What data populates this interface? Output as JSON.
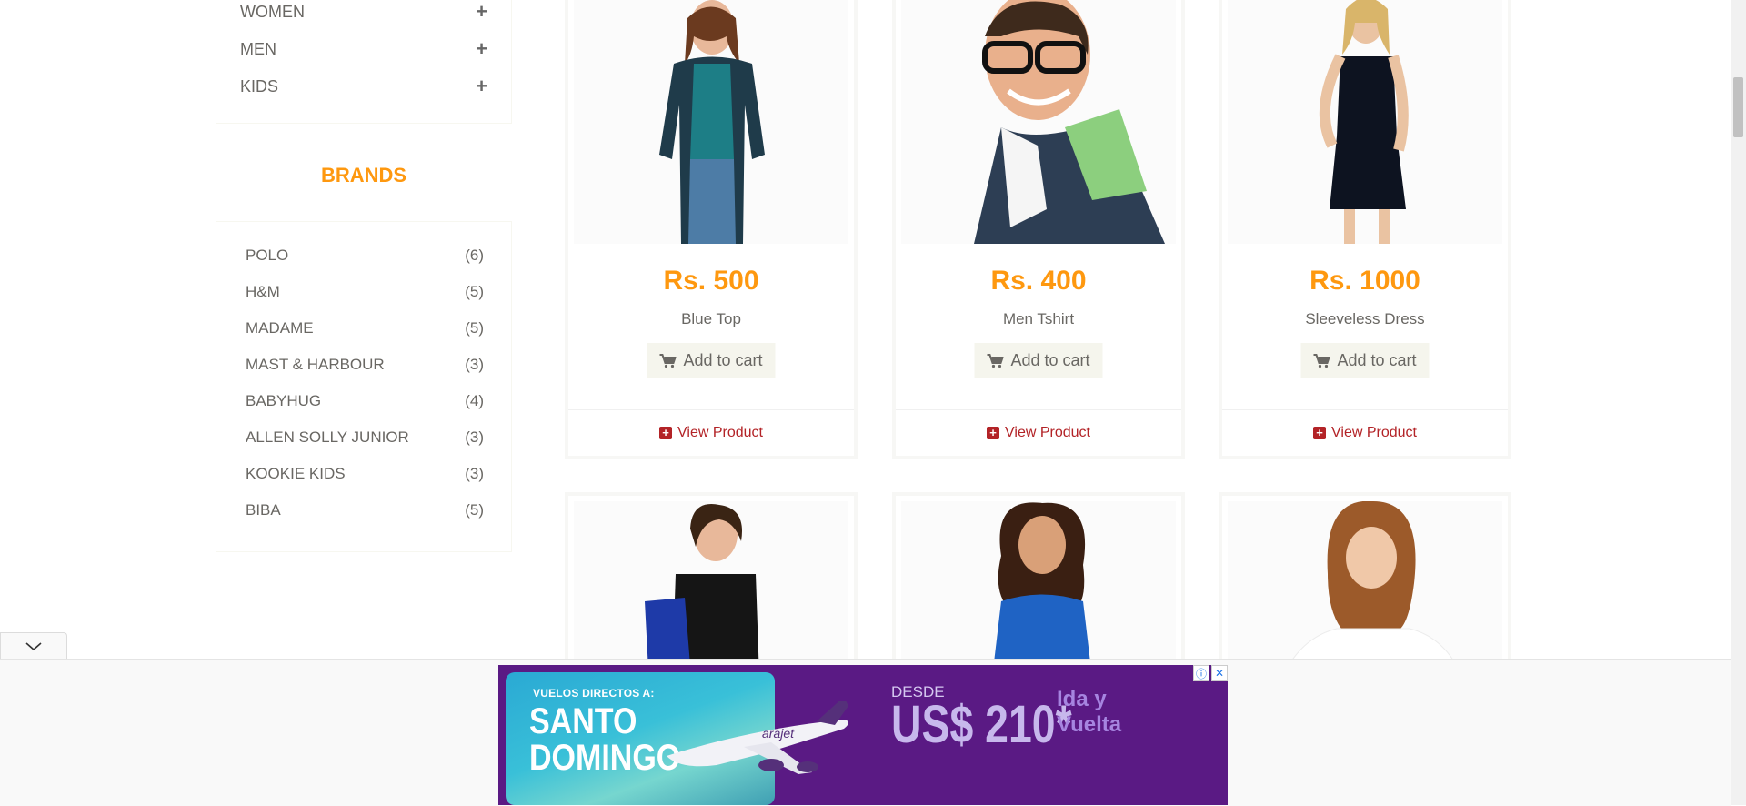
{
  "categories": [
    {
      "label": "WOMEN"
    },
    {
      "label": "MEN"
    },
    {
      "label": "KIDS"
    }
  ],
  "brands": {
    "title": "BRANDS",
    "items": [
      {
        "name": "POLO",
        "count": "(6)"
      },
      {
        "name": "H&M",
        "count": "(5)"
      },
      {
        "name": "MADAME",
        "count": "(5)"
      },
      {
        "name": "MAST & HARBOUR",
        "count": "(3)"
      },
      {
        "name": "BABYHUG",
        "count": "(4)"
      },
      {
        "name": "ALLEN SOLLY JUNIOR",
        "count": "(3)"
      },
      {
        "name": "KOOKIE KIDS",
        "count": "(3)"
      },
      {
        "name": "BIBA",
        "count": "(5)"
      }
    ]
  },
  "products": [
    {
      "price": "Rs. 500",
      "name": "Blue Top",
      "add_label": "Add to cart",
      "view_label": "View Product"
    },
    {
      "price": "Rs. 400",
      "name": "Men Tshirt",
      "add_label": "Add to cart",
      "view_label": "View Product"
    },
    {
      "price": "Rs. 1000",
      "name": "Sleeveless Dress",
      "add_label": "Add to cart",
      "view_label": "View Product"
    }
  ],
  "ad": {
    "small_text": "VUELOS DIRECTOS A:",
    "destination_line1": "SANTO",
    "destination_line2": "DOMINGO",
    "desde": "DESDE",
    "price": "US$ 210*",
    "trip_line1": "Ida y",
    "trip_line2": "Vuelta",
    "brand": "arajet"
  },
  "colors": {
    "accent": "#fe980f",
    "link": "#b32327",
    "ad_bg": "#5a1a84"
  }
}
